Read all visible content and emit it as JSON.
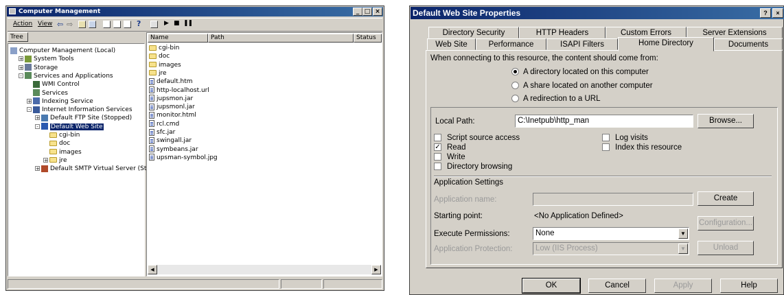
{
  "mmc": {
    "title": "Computer Management",
    "window_controls": [
      "_",
      "□",
      "×"
    ],
    "menu": {
      "action": "Action",
      "view": "View"
    },
    "tree_tab": "Tree",
    "tree": [
      {
        "label": "Computer Management (Local)",
        "icon": "computer-icon",
        "level": 0,
        "expander": ""
      },
      {
        "label": "System Tools",
        "icon": "tools-icon",
        "level": 1,
        "expander": "+"
      },
      {
        "label": "Storage",
        "icon": "storage-icon",
        "level": 1,
        "expander": "+"
      },
      {
        "label": "Services and Applications",
        "icon": "services-icon",
        "level": 1,
        "expander": "-"
      },
      {
        "label": "WMI Control",
        "icon": "wmi-icon",
        "level": 2,
        "expander": ""
      },
      {
        "label": "Services",
        "icon": "services-icon",
        "level": 2,
        "expander": ""
      },
      {
        "label": "Indexing Service",
        "icon": "indexing-icon",
        "level": 2,
        "expander": "+"
      },
      {
        "label": "Internet Information Services",
        "icon": "iis-icon",
        "level": 2,
        "expander": "-"
      },
      {
        "label": "Default FTP Site (Stopped)",
        "icon": "ftp-icon",
        "level": 3,
        "expander": "+"
      },
      {
        "label": "Default Web Site",
        "icon": "website-icon",
        "level": 3,
        "expander": "-",
        "selected": true
      },
      {
        "label": "cgi-bin",
        "icon": "folder-icon",
        "level": 4,
        "expander": ""
      },
      {
        "label": "doc",
        "icon": "folder-icon",
        "level": 4,
        "expander": ""
      },
      {
        "label": "images",
        "icon": "folder-icon",
        "level": 4,
        "expander": ""
      },
      {
        "label": "jre",
        "icon": "folder-icon",
        "level": 4,
        "expander": "+"
      },
      {
        "label": "Default SMTP Virtual Server (Stopped)",
        "icon": "smtp-icon",
        "level": 3,
        "expander": "+"
      }
    ],
    "columns": {
      "name": "Name",
      "path": "Path",
      "status": "Status"
    },
    "files": [
      {
        "name": "cgi-bin",
        "type": "folder"
      },
      {
        "name": "doc",
        "type": "folder"
      },
      {
        "name": "images",
        "type": "folder"
      },
      {
        "name": "jre",
        "type": "folder"
      },
      {
        "name": "default.htm",
        "type": "file"
      },
      {
        "name": "http-localhost.url",
        "type": "file"
      },
      {
        "name": "jupsmon.jar",
        "type": "file"
      },
      {
        "name": "jupsmonl.jar",
        "type": "file"
      },
      {
        "name": "monitor.html",
        "type": "file"
      },
      {
        "name": "rcl.cmd",
        "type": "file"
      },
      {
        "name": "sfc.jar",
        "type": "file"
      },
      {
        "name": "swingall.jar",
        "type": "file"
      },
      {
        "name": "symbeans.jar",
        "type": "file"
      },
      {
        "name": "upsman-symbol.jpg",
        "type": "file"
      }
    ]
  },
  "dialog": {
    "title": "Default Web Site Properties",
    "help_btn": "?",
    "close_btn": "×",
    "tabs_back": [
      "Directory Security",
      "HTTP Headers",
      "Custom Errors",
      "Server Extensions"
    ],
    "tabs_front": [
      "Web Site",
      "Performance",
      "ISAPI Filters",
      "Home Directory",
      "Documents"
    ],
    "active_tab": "Home Directory",
    "connect_prompt": "When connecting to this resource, the content should come from:",
    "source_options": [
      {
        "label": "A directory located on this computer",
        "selected": true
      },
      {
        "label": "A share located on another computer",
        "selected": false
      },
      {
        "label": "A redirection to a URL",
        "selected": false
      }
    ],
    "local_path_label": "Local Path:",
    "local_path_value": "C:\\Inetpub\\http_man",
    "browse_btn": "Browse...",
    "checks_left": [
      {
        "label": "Script source access",
        "checked": false
      },
      {
        "label": "Read",
        "checked": true
      },
      {
        "label": "Write",
        "checked": false
      },
      {
        "label": "Directory browsing",
        "checked": false
      }
    ],
    "checks_right": [
      {
        "label": "Log visits",
        "checked": false
      },
      {
        "label": "Index this resource",
        "checked": false
      }
    ],
    "app_settings_label": "Application Settings",
    "app_name_label": "Application name:",
    "create_btn": "Create",
    "starting_point_label": "Starting point:",
    "starting_point_value": "<No Application Defined>",
    "configuration_btn": "Configuration...",
    "exec_perm_label": "Execute Permissions:",
    "exec_perm_value": "None",
    "app_protection_label": "Application Protection:",
    "app_protection_value": "Low (IIS Process)",
    "unload_btn": "Unload",
    "ok_btn": "OK",
    "cancel_btn": "Cancel",
    "apply_btn": "Apply",
    "help_bottom_btn": "Help"
  }
}
